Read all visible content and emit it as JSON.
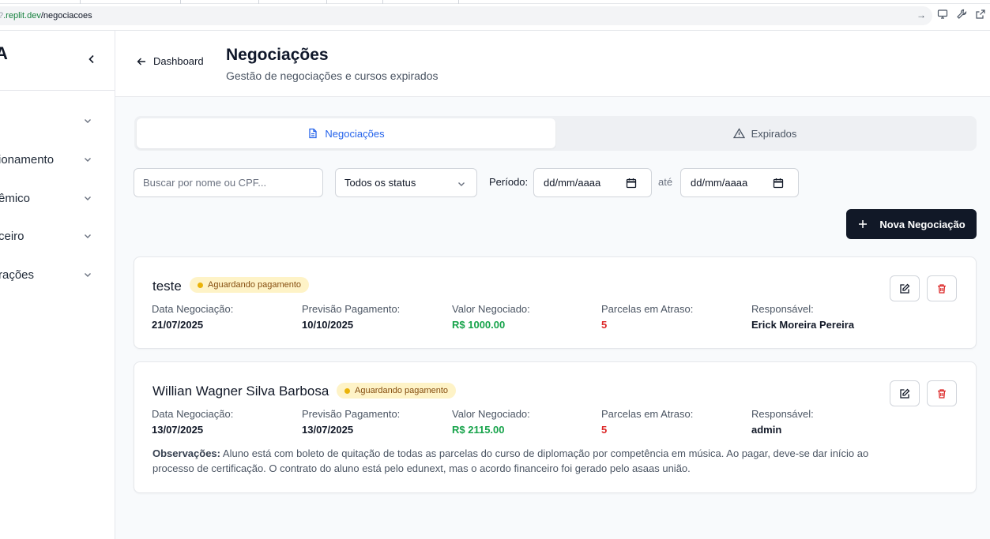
{
  "browser": {
    "url_host": ".replit.dev",
    "url_path": "/negociacoes"
  },
  "sidebar": {
    "brand": "A",
    "items": [
      {
        "label": ""
      },
      {
        "label": "ionamento"
      },
      {
        "label": "êmico"
      },
      {
        "label": "ceiro"
      },
      {
        "label": "rações"
      }
    ]
  },
  "header": {
    "back_label": "Dashboard",
    "title": "Negociações",
    "subtitle": "Gestão de negociações e cursos expirados"
  },
  "tabs": [
    {
      "label": "Negociações",
      "icon": "document-icon",
      "active": true
    },
    {
      "label": "Expirados",
      "icon": "warning-icon",
      "active": false
    }
  ],
  "filters": {
    "search_placeholder": "Buscar por nome ou CPF...",
    "status_value": "Todos os status",
    "periodo_label": "Período:",
    "date_from": "dd/mm/aaaa",
    "ate_label": "até",
    "date_to": "dd/mm/aaaa"
  },
  "new_button_label": "Nova Negociação",
  "cards": [
    {
      "name": "teste",
      "status": "Aguardando pagamento",
      "fields": [
        {
          "label": "Data Negociação:",
          "value": "21/07/2025"
        },
        {
          "label": "Previsão Pagamento:",
          "value": "10/10/2025"
        },
        {
          "label": "Valor Negociado:",
          "value": "R$ 1000.00"
        },
        {
          "label": "Parcelas em Atraso:",
          "value": "5"
        },
        {
          "label": "Responsável:",
          "value": "Erick Moreira Pereira"
        }
      ],
      "observacoes": null
    },
    {
      "name": "Willian Wagner Silva Barbosa",
      "status": "Aguardando pagamento",
      "fields": [
        {
          "label": "Data Negociação:",
          "value": "13/07/2025"
        },
        {
          "label": "Previsão Pagamento:",
          "value": "13/07/2025"
        },
        {
          "label": "Valor Negociado:",
          "value": "R$ 2115.00"
        },
        {
          "label": "Parcelas em Atraso:",
          "value": "5"
        },
        {
          "label": "Responsável:",
          "value": "admin"
        }
      ],
      "observacoes_label": "Observações:",
      "observacoes": "Aluno está com boleto de quitação de todas as parcelas do curso de diplomação por competência em música. Ao pagar, deve-se dar início ao processo de certificação. O contrato do aluno está pelo edunext, mas o acordo financeiro foi gerado pelo asaas união."
    }
  ],
  "colors": {
    "accent": "#2563eb",
    "primary_button": "#111827",
    "badge_bg": "#fef3c7",
    "badge_dot": "#eab308",
    "money": "#16a34a",
    "late": "#dc2626"
  }
}
